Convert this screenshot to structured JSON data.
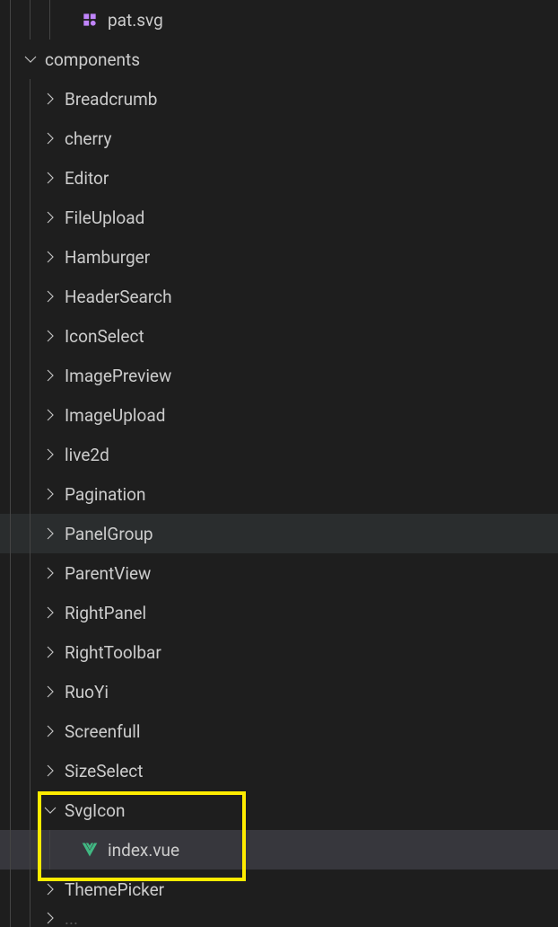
{
  "tree": {
    "items": [
      {
        "type": "file",
        "depth": 3,
        "name": "pat.svg",
        "icon": "svg-file",
        "highlight": "none"
      },
      {
        "type": "folder",
        "depth": 1,
        "name": "components",
        "expanded": true,
        "highlight": "none"
      },
      {
        "type": "folder",
        "depth": 2,
        "name": "Breadcrumb",
        "expanded": false,
        "highlight": "none"
      },
      {
        "type": "folder",
        "depth": 2,
        "name": "cherry",
        "expanded": false,
        "highlight": "none"
      },
      {
        "type": "folder",
        "depth": 2,
        "name": "Editor",
        "expanded": false,
        "highlight": "none"
      },
      {
        "type": "folder",
        "depth": 2,
        "name": "FileUpload",
        "expanded": false,
        "highlight": "none"
      },
      {
        "type": "folder",
        "depth": 2,
        "name": "Hamburger",
        "expanded": false,
        "highlight": "none"
      },
      {
        "type": "folder",
        "depth": 2,
        "name": "HeaderSearch",
        "expanded": false,
        "highlight": "none"
      },
      {
        "type": "folder",
        "depth": 2,
        "name": "IconSelect",
        "expanded": false,
        "highlight": "none"
      },
      {
        "type": "folder",
        "depth": 2,
        "name": "ImagePreview",
        "expanded": false,
        "highlight": "none"
      },
      {
        "type": "folder",
        "depth": 2,
        "name": "ImageUpload",
        "expanded": false,
        "highlight": "none"
      },
      {
        "type": "folder",
        "depth": 2,
        "name": "live2d",
        "expanded": false,
        "highlight": "none"
      },
      {
        "type": "folder",
        "depth": 2,
        "name": "Pagination",
        "expanded": false,
        "highlight": "none"
      },
      {
        "type": "folder",
        "depth": 2,
        "name": "PanelGroup",
        "expanded": false,
        "highlight": "highlighted"
      },
      {
        "type": "folder",
        "depth": 2,
        "name": "ParentView",
        "expanded": false,
        "highlight": "none"
      },
      {
        "type": "folder",
        "depth": 2,
        "name": "RightPanel",
        "expanded": false,
        "highlight": "none"
      },
      {
        "type": "folder",
        "depth": 2,
        "name": "RightToolbar",
        "expanded": false,
        "highlight": "none"
      },
      {
        "type": "folder",
        "depth": 2,
        "name": "RuoYi",
        "expanded": false,
        "highlight": "none"
      },
      {
        "type": "folder",
        "depth": 2,
        "name": "Screenfull",
        "expanded": false,
        "highlight": "none"
      },
      {
        "type": "folder",
        "depth": 2,
        "name": "SizeSelect",
        "expanded": false,
        "highlight": "none"
      },
      {
        "type": "folder",
        "depth": 2,
        "name": "SvgIcon",
        "expanded": true,
        "highlight": "none"
      },
      {
        "type": "file",
        "depth": 3,
        "name": "index.vue",
        "icon": "vue-file",
        "highlight": "selected"
      },
      {
        "type": "folder",
        "depth": 2,
        "name": "ThemePicker",
        "expanded": false,
        "highlight": "none"
      }
    ]
  }
}
